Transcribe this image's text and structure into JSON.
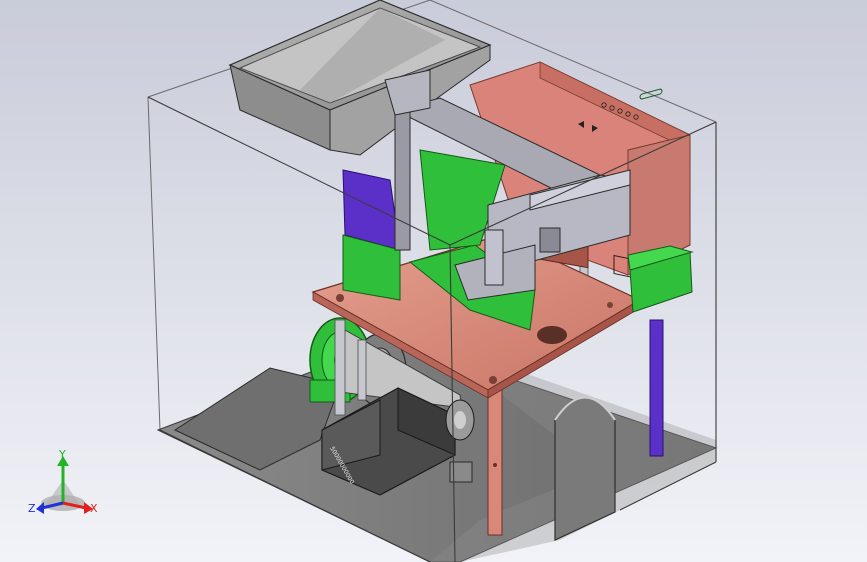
{
  "viewport": {
    "background_top": "#c9ccd9",
    "background_bottom": "#f2f3f8"
  },
  "triad": {
    "x_label": "X",
    "y_label": "Y",
    "z_label": "Z",
    "x_color": "#e0211d",
    "y_color": "#22b326",
    "z_color": "#2330d6"
  },
  "model": {
    "enclosure_stroke": "#3a3a3a",
    "hopper_color": "#9a9a9a",
    "plate_color": "#d98778",
    "control_box_color": "#d9837a",
    "green_part_color": "#2fbf3a",
    "purple_part_color": "#5a30c8",
    "rod_color": "#bdbdc6",
    "motor_color": "#4a4a4a",
    "base_color": "#7b7b7b",
    "motor_label": "50000000000"
  }
}
